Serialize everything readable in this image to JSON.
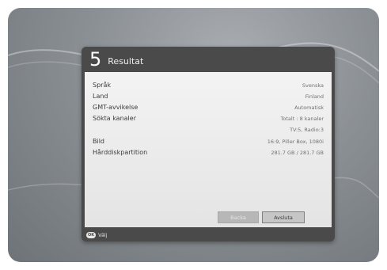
{
  "dialog": {
    "step_number": "5",
    "title": "Resultat"
  },
  "rows": [
    {
      "label": "Språk",
      "value": "Svenska"
    },
    {
      "label": "Land",
      "value": "Finland"
    },
    {
      "label": "GMT-avvikelse",
      "value": "Automatisk"
    },
    {
      "label": "Sökta kanaler",
      "value": "Totalt : 8 kanaler"
    },
    {
      "label": "",
      "value": "TV:5, Radio:3"
    },
    {
      "label": "Bild",
      "value": "16:9, Piller Box, 1080i"
    },
    {
      "label": "Hårddiskpartition",
      "value": "281.7 GB / 281.7 GB"
    }
  ],
  "buttons": {
    "back": "Backa",
    "finish": "Avsluta"
  },
  "footer": {
    "ok_icon": "OK",
    "label": "Välj"
  }
}
